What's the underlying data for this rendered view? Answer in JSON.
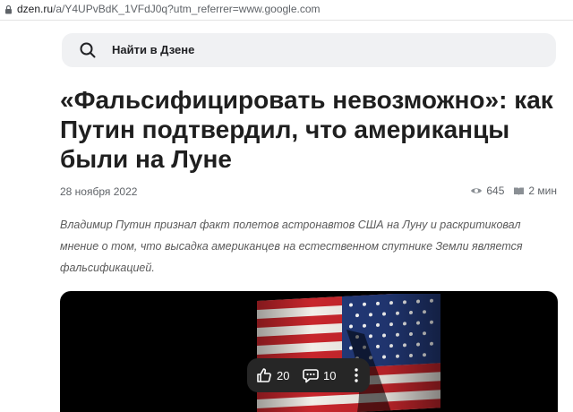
{
  "browser": {
    "url_domain": "dzen.ru",
    "url_path": "/a/Y4UPvBdK_1VFdJ0q?utm_referrer=www.google.com"
  },
  "header": {
    "search_label": "Найти в Дзене"
  },
  "article": {
    "title": "«Фальсифицировать невозможно»: как Путин подтвердил, что американцы были на Луне",
    "date": "28 ноября 2022",
    "views": "645",
    "read_time": "2 мин",
    "lead": "Владимир Путин признал факт полетов астронавтов США на Луну и раскритиковал мнение о том, что высадка американцев на естественном спутнике Земли является фальсификацией."
  },
  "controls": {
    "likes": "20",
    "comments": "10"
  },
  "icons": {
    "search": "search-icon",
    "views": "eye-icon",
    "read_time": "book-icon",
    "like": "thumb-up-icon",
    "comment": "comment-icon",
    "more": "more-vertical-icon",
    "lock": "lock-icon"
  },
  "colors": {
    "search_bg": "#f0f1f3",
    "title": "#1f1f1f",
    "meta": "#5f6368",
    "controls_bg": "#262626",
    "media_bg": "#000000"
  }
}
